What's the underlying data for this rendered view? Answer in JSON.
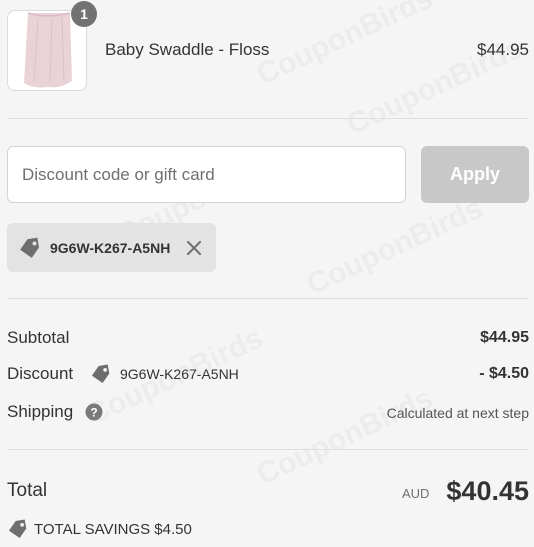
{
  "product": {
    "name": "Baby Swaddle - Floss",
    "price": "$44.95",
    "quantity": "1",
    "image_icon": "swaddle-blanket-image"
  },
  "discount": {
    "placeholder": "Discount code or gift card",
    "apply_label": "Apply",
    "applied_code": "9G6W-K267-A5NH"
  },
  "summary": {
    "subtotal_label": "Subtotal",
    "subtotal_value": "$44.95",
    "discount_label": "Discount",
    "discount_code": "9G6W-K267-A5NH",
    "discount_value": "- $4.50",
    "shipping_label": "Shipping",
    "shipping_value": "Calculated at next step"
  },
  "total": {
    "label": "Total",
    "currency": "AUD",
    "amount": "$40.45",
    "savings": "TOTAL SAVINGS $4.50"
  },
  "watermark": "CouponBirds",
  "colors": {
    "background": "#f5f5f5",
    "apply_disabled": "#c8c8c8",
    "chip_bg": "#e3e3e3",
    "badge": "#727272",
    "text": "#333333"
  }
}
